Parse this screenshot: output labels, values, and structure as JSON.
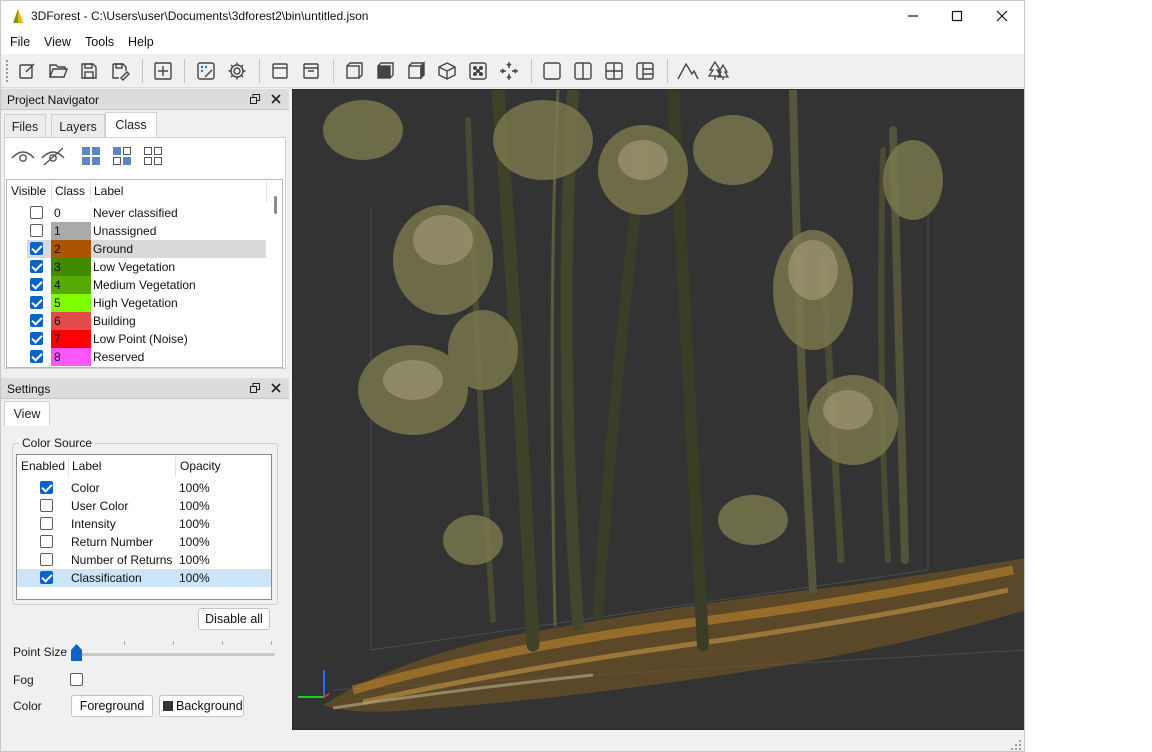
{
  "window": {
    "title": "3DForest - C:\\Users\\user\\Documents\\3dforest2\\bin\\untitled.json",
    "minimize_icon": "minimize-icon",
    "maximize_icon": "maximize-icon",
    "close_icon": "close-icon"
  },
  "menu": {
    "items": [
      "File",
      "View",
      "Tools",
      "Help"
    ]
  },
  "toolbar": {
    "icons": [
      "new-project-icon",
      "open-project-icon",
      "save-icon",
      "save-as-icon",
      "add-import-icon",
      "edit-settings-icon",
      "gear-icon",
      "view-top-icon",
      "view-bottom-icon",
      "view-front-icon",
      "view-back-icon",
      "view-left-icon",
      "view-3d-icon",
      "fit-view-icon",
      "reset-view-icon",
      "layout-single-icon",
      "layout-two-icon",
      "layout-four-icon",
      "layout-three-icon",
      "terrain-icon",
      "trees-icon"
    ]
  },
  "project_navigator": {
    "title": "Project Navigator",
    "tabs": [
      "Files",
      "Layers",
      "Class"
    ],
    "active_tab": "Class",
    "toolbar_icons": [
      "eye-icon",
      "eye-off-icon",
      "select-all-icon",
      "invert-icon",
      "select-none-icon"
    ],
    "headers": {
      "visible": "Visible",
      "class": "Class",
      "label": "Label"
    },
    "rows": [
      {
        "visible": false,
        "class": "0",
        "label": "Never classified",
        "color": "#ffffff"
      },
      {
        "visible": false,
        "class": "1",
        "label": "Unassigned",
        "color": "#aaaaaa"
      },
      {
        "visible": true,
        "class": "2",
        "label": "Ground",
        "color": "#aa5500",
        "selected": true
      },
      {
        "visible": true,
        "class": "3",
        "label": "Low Vegetation",
        "color": "#3f8a00"
      },
      {
        "visible": true,
        "class": "4",
        "label": "Medium Vegetation",
        "color": "#55aa00"
      },
      {
        "visible": true,
        "class": "5",
        "label": "High Vegetation",
        "color": "#80ff00"
      },
      {
        "visible": true,
        "class": "6",
        "label": "Building",
        "color": "#e34a4a"
      },
      {
        "visible": true,
        "class": "7",
        "label": "Low Point (Noise)",
        "color": "#ff0000"
      },
      {
        "visible": true,
        "class": "8",
        "label": "Reserved",
        "color": "#ff55ff"
      }
    ]
  },
  "settings": {
    "title": "Settings",
    "tab": "View",
    "color_source": {
      "group_title": "Color Source",
      "headers": {
        "enabled": "Enabled",
        "label": "Label",
        "opacity": "Opacity"
      },
      "rows": [
        {
          "enabled": true,
          "label": "Color",
          "opacity": "100%"
        },
        {
          "enabled": false,
          "label": "User Color",
          "opacity": "100%"
        },
        {
          "enabled": false,
          "label": "Intensity",
          "opacity": "100%"
        },
        {
          "enabled": false,
          "label": "Return Number",
          "opacity": "100%"
        },
        {
          "enabled": false,
          "label": "Number of Returns",
          "opacity": "100%"
        },
        {
          "enabled": true,
          "label": "Classification",
          "opacity": "100%",
          "selected": true
        }
      ],
      "disable_all": "Disable all"
    },
    "point_size_label": "Point Size",
    "point_size_level": 0,
    "fog_label": "Fog",
    "fog_enabled": false,
    "color_label": "Color",
    "foreground_button": "Foreground",
    "background_button": "Background"
  },
  "viewport": {
    "background": "#333333"
  }
}
